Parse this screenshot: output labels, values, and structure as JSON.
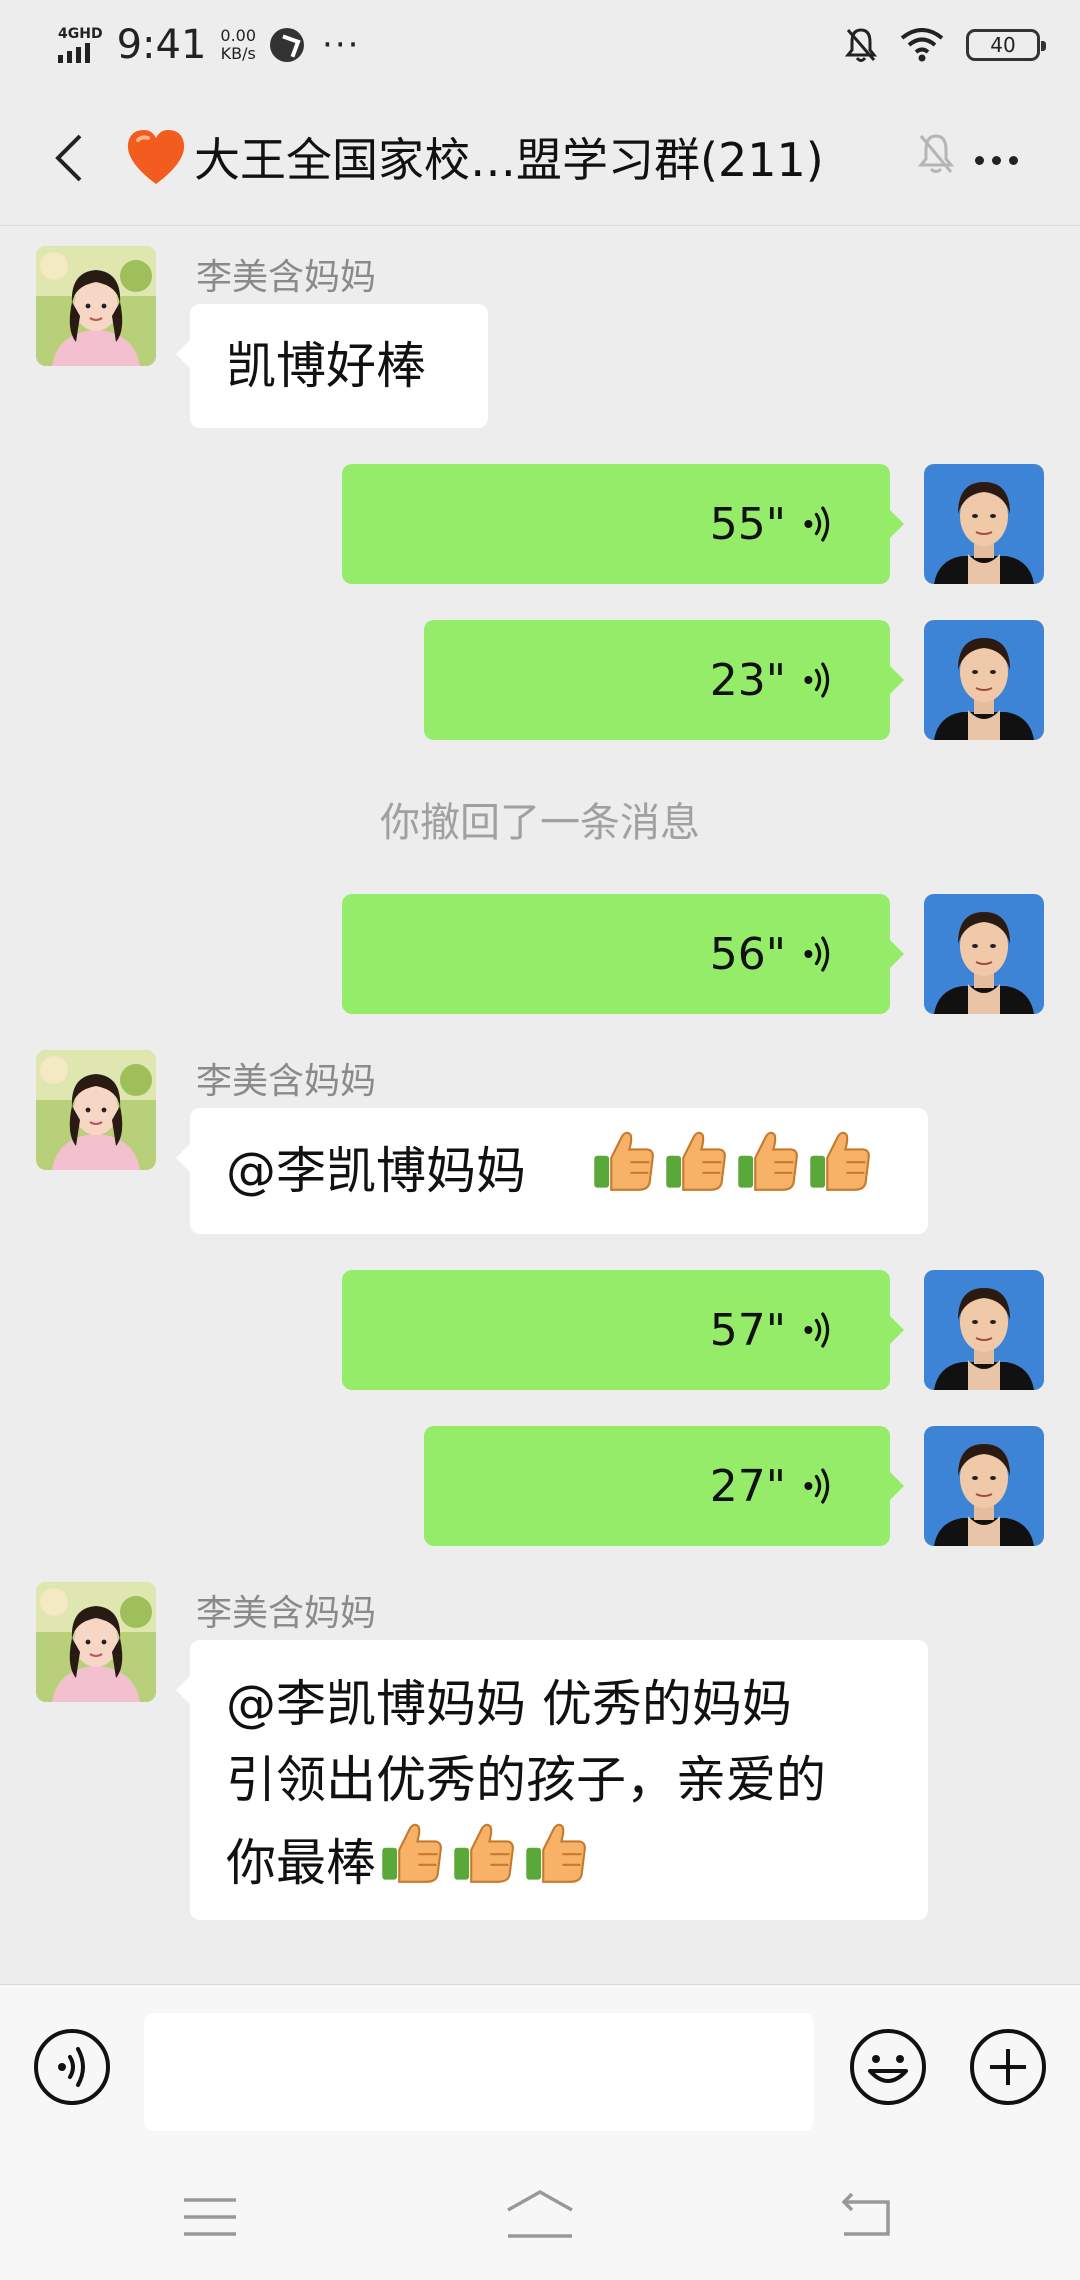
{
  "status_bar": {
    "network": "4GHD",
    "time": "9:41",
    "speed_value": "0.00",
    "speed_unit": "KB/s",
    "more": "···",
    "battery": "40"
  },
  "header": {
    "title": "大王全国家校…盟学习群(211)"
  },
  "messages": {
    "m1": {
      "sender": "李美含妈妈",
      "text": "凯博好棒"
    },
    "m2": {
      "duration": "55\""
    },
    "m3": {
      "duration": "23\""
    },
    "recall": "你撤回了一条消息",
    "m4": {
      "duration": "56\""
    },
    "m5": {
      "sender": "李美含妈妈",
      "text": "@李凯博妈妈"
    },
    "m6": {
      "duration": "57\""
    },
    "m7": {
      "duration": "27\""
    },
    "m8": {
      "sender": "李美含妈妈",
      "line1": "@李凯博妈妈  优秀的妈妈",
      "line2": "引领出优秀的孩子，亲爱的",
      "line3": "你最棒"
    }
  },
  "colors": {
    "background": "#ededed",
    "out_bubble": "#95ec69",
    "in_bubble": "#ffffff",
    "avatar_blue": "#3d84d6"
  }
}
